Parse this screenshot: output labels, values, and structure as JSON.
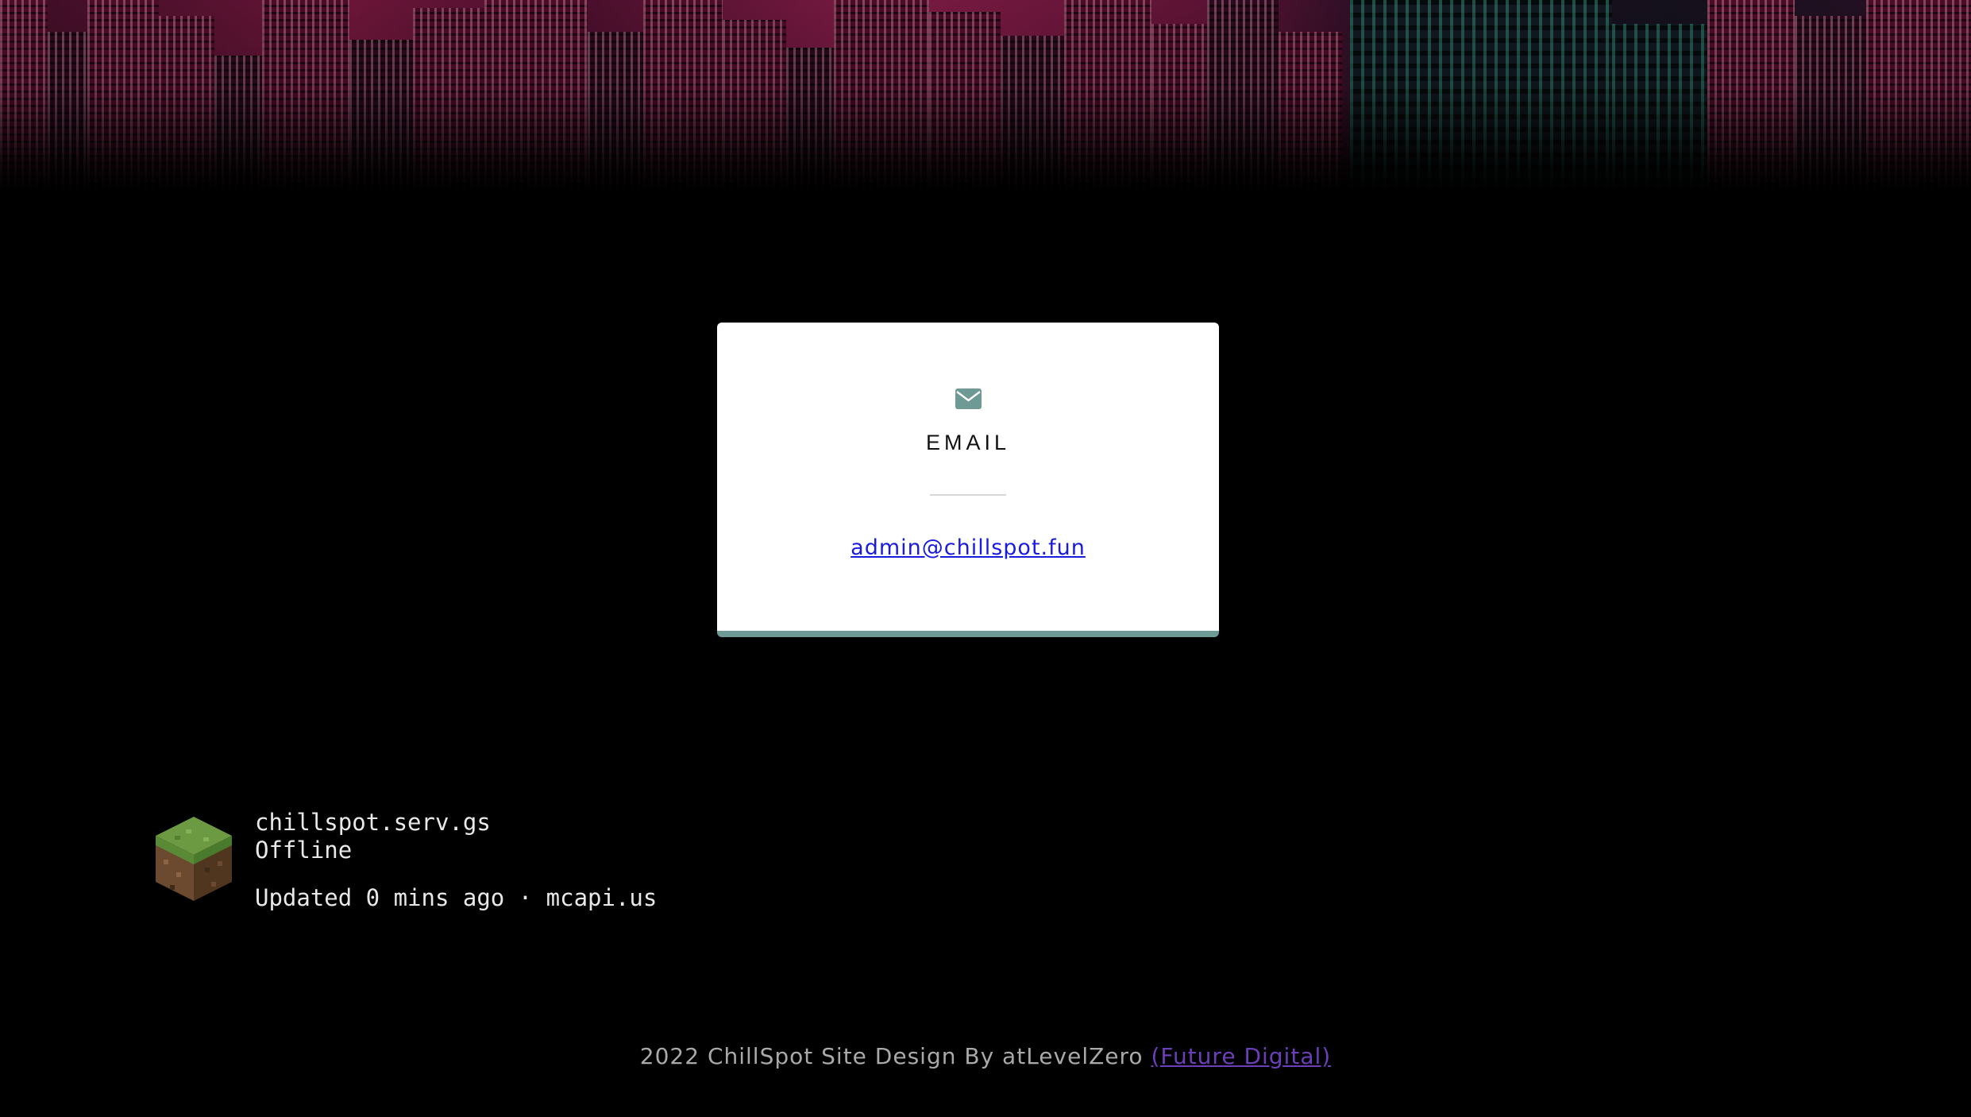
{
  "card": {
    "icon": "envelope-icon",
    "title": "EMAIL",
    "email": "admin@chillspot.fun"
  },
  "server": {
    "icon": "grass-block-icon",
    "host": "chillspot.serv.gs",
    "status": "Offline",
    "updated": "Updated 0 mins ago · mcapi.us"
  },
  "footer": {
    "text": "2022 ChillSpot Site Design By atLevelZero",
    "link_label": "(Future Digital)"
  },
  "colors": {
    "accent": "#6e9a96",
    "link": "#1a1ae0",
    "footer_link": "#6a3fb8",
    "background": "#000000"
  }
}
